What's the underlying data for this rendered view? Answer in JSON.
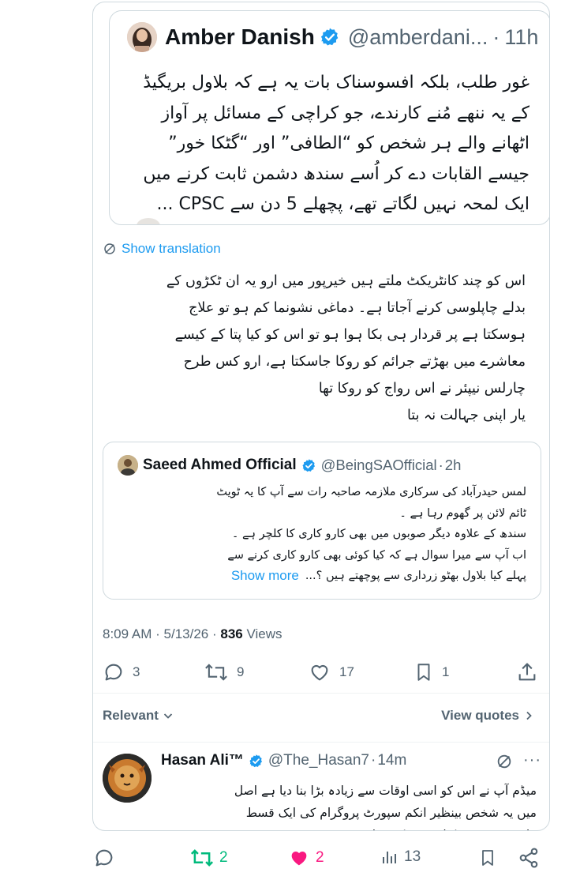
{
  "quoted_tweet": {
    "author_name": "Amber Danish",
    "handle": "@amberdani...",
    "separator": "·",
    "time": "11h",
    "body_lines": [
      "غور طلب، بلکہ افسوسناک بات یہ ہے کہ بلاول بریگیڈ",
      "کے یہ ننھے مُنے کارندے، جو کراچی کے مسائل پر آواز",
      "اٹھانے والے ہر شخص کو “الطافی” اور “گٹکا خور”",
      "جیسے القابات دے کر اُسے سندھ دشمن ثابت کرنے میں",
      "ایک لمحہ نہیں لگاتے تھے، پچھلے 5 دن سے CPSC ..."
    ],
    "avatar_icon": "profile-photo",
    "verified_icon": "verified-badge-icon",
    "verified_color": "#1d9bf0"
  },
  "translation": {
    "label": "Show translation",
    "icon": "translate-icon"
  },
  "main_tweet": {
    "body_lines": [
      "اس کو چند کانٹریکٹ ملتے ہیں خیرپور میں ارو یہ ان ٹکڑوں کے",
      "بدلے چاپلوسی کرنے آجاتا ہے۔ دماغی نشونما کم ہو تو علاج",
      "ہوسکتا ہے پر قردار ہی بکا ہوا ہو تو اس کو کیا پتا کے کیسے",
      "معاشرے میں بھڑتے جرائم کو روکا جاسکتا ہے، ارو کس طرح",
      "چارلس نیپئر نے اس رواج کو روکا تھا",
      "یار اپنی جہالت نہ بتا"
    ]
  },
  "embedded_quote": {
    "author_name": "Saeed Ahmed Official",
    "handle": "@BeingSAOfficial",
    "separator": "·",
    "time": "2h",
    "body_lines": [
      "لمس حیدرآباد کی سرکاری ملازمہ صاحبہ رات سے آپ کا یہ ٹویٹ",
      "ٹائم لائن پر گھوم رہا ہے ۔",
      "سندھ کے علاوہ دیگر صوبوں میں بھی کارو کاری کا کلچر ہے ۔",
      "اب آپ سے میرا سوال ہے کہ کیا کوئی بھی کارو کاری کرنے سے",
      "پہلے کیا بلاول بھٹو زرداری سے پوچھتے ہیں ؟..."
    ],
    "show_more": "Show more"
  },
  "meta": {
    "time": "8:09 AM",
    "date": "5/13/26",
    "views_count": "836",
    "views_label": "Views"
  },
  "actions": {
    "replies": "3",
    "reposts": "9",
    "likes": "17",
    "bookmarks": "1"
  },
  "sorting": {
    "relevant_label": "Relevant",
    "view_quotes_label": "View quotes"
  },
  "reply": {
    "author_name": "Hasan Ali™",
    "handle": "@The_Hasan7",
    "separator": "·",
    "time": "14m",
    "body_lines": [
      "میڈم آپ نے اس کو اسی اوقات سے زیادہ بڑا بنا دیا ہے اصل",
      "میں یہ شخص بینظیر انکم سپورٹ پروگرام کی ایک قسط",
      "ملنے پر ہی بھونکنا شروع کر دیتا ہے"
    ]
  },
  "bottom_bar": {
    "reposts": "2",
    "likes": "2",
    "views": "13",
    "repost_color": "#00ba7c",
    "like_color": "#f91880"
  }
}
